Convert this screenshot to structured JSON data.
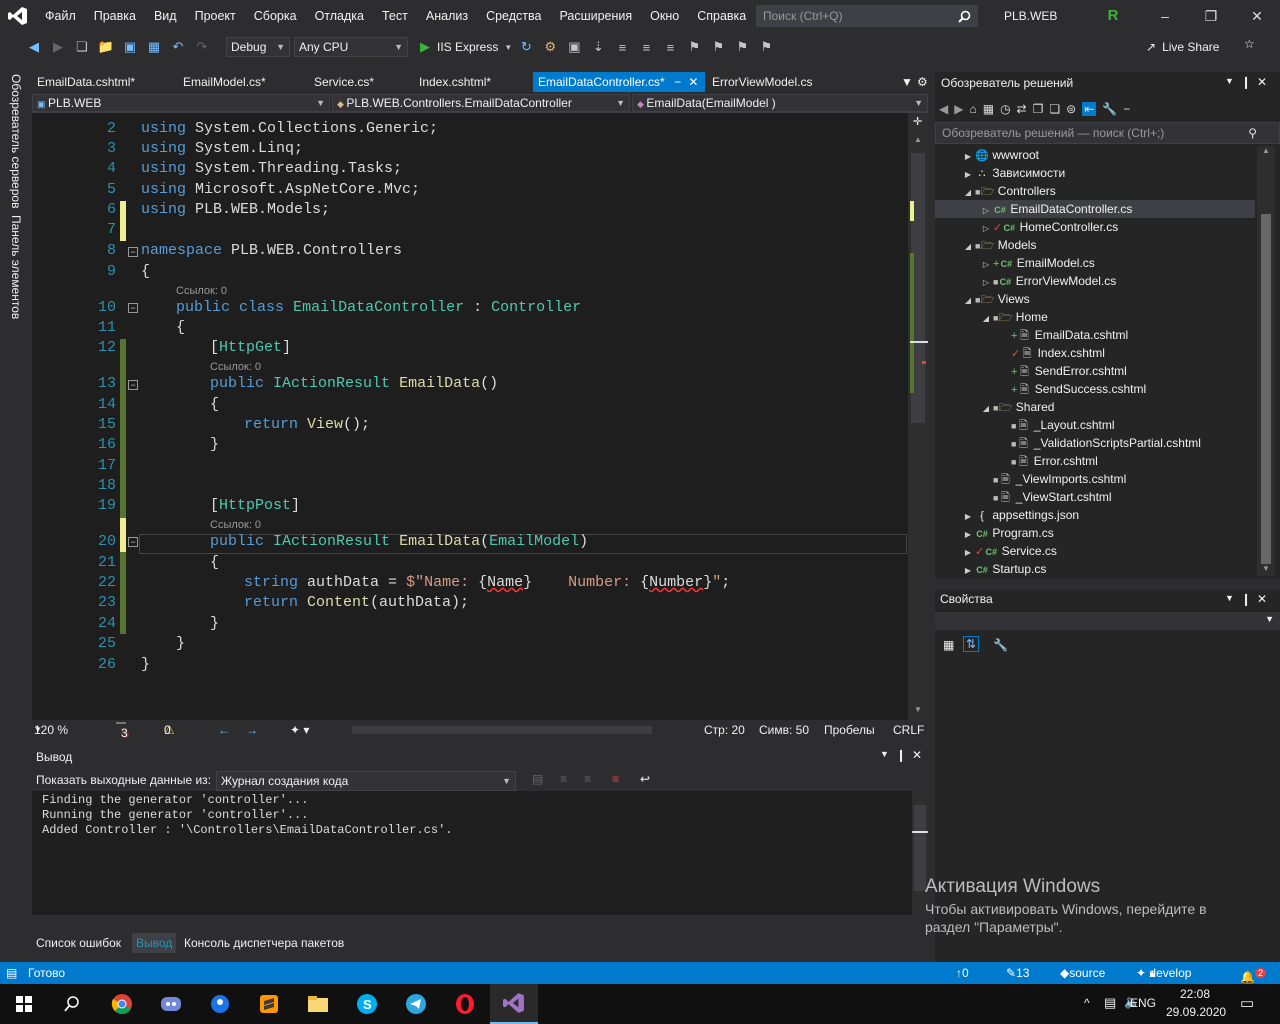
{
  "menu": {
    "items": [
      "Файл",
      "Правка",
      "Вид",
      "Проект",
      "Сборка",
      "Отладка",
      "Тест",
      "Анализ",
      "Средства",
      "Расширения",
      "Окно",
      "Справка"
    ],
    "search_placeholder": "Поиск (Ctrl+Q)",
    "project_name": "PLB.WEB",
    "avatar_letter": "R"
  },
  "toolbar": {
    "config": "Debug",
    "platform": "Any CPU",
    "run_target": "IIS Express",
    "live_share": "Live Share"
  },
  "tabs": [
    {
      "label": "EmailData.cshtml*"
    },
    {
      "label": "EmailModel.cs*"
    },
    {
      "label": "Service.cs*"
    },
    {
      "label": "Index.cshtml*"
    },
    {
      "label": "EmailDataController.cs*"
    },
    {
      "label": "ErrorViewModel.cs"
    }
  ],
  "navbar": {
    "project": "PLB.WEB",
    "class": "PLB.WEB.Controllers.EmailDataController",
    "member": "EmailData(EmailModel )"
  },
  "left_strip": {
    "server_explorer": "Обозреватель серверов",
    "toolbox": "Панель элементов"
  },
  "code": {
    "ref_label": "Ссылок: 0",
    "line_numbers": [
      "2",
      "3",
      "4",
      "5",
      "6",
      "7",
      "8",
      "9",
      "10",
      "11",
      "12",
      "13",
      "14",
      "15",
      "16",
      "17",
      "18",
      "19",
      "20",
      "21",
      "22",
      "23",
      "24",
      "25",
      "26"
    ],
    "lines": {
      "l2_kw": "using",
      "l2_rest": " System.Collections.Generic;",
      "l3_kw": "using",
      "l3_rest": " System.Linq;",
      "l4_kw": "using",
      "l4_rest": " System.Threading.Tasks;",
      "l5_kw": "using",
      "l5_rest": " Microsoft.AspNetCore.Mvc;",
      "l6_kw": "using",
      "l6_rest": " PLB.WEB.Models;",
      "l8_kw": "namespace",
      "l8_rest": " PLB.WEB.Controllers",
      "brace_open": "{",
      "brace_close": "}",
      "l10_kw1": "public",
      "l10_kw2": "class",
      "l10_name": "EmailDataController",
      "l10_colon": " : ",
      "l10_base": "Controller",
      "l12_attr": "HttpGet",
      "l13_kw": "public",
      "l13_type": "IActionResult",
      "l13_name": "EmailData",
      "l13_parens": "()",
      "l15_kw": "return",
      "l15_fn": "View",
      "l15_rest": "();",
      "l19_attr": "HttpPost",
      "l20_kw": "public",
      "l20_type": "IActionResult",
      "l20_name": "EmailData",
      "l20_open": "(",
      "l20_param": "EmailModel",
      "l20_close": ")",
      "l22_kw": "string",
      "l22_var": "authData",
      "l22_eq": " = ",
      "l22_s1": "$\"Name: ",
      "l22_i1": "Name",
      "l22_s2": "    Number: ",
      "l22_i2": "Number",
      "l22_s3": "\"",
      "l22_end": ";",
      "l23_kw": "return",
      "l23_fn": "Content",
      "l23_rest": "(authData);"
    }
  },
  "editor_status": {
    "zoom": "120 %",
    "errors": "3",
    "warnings": "0",
    "line": "Стр: 20",
    "col": "Симв: 50",
    "spaces": "Пробелы",
    "eol": "CRLF"
  },
  "output": {
    "title": "Вывод",
    "show_label": "Показать выходные данные из:",
    "source": "Журнал создания кода",
    "lines": [
      "Finding the generator 'controller'...",
      "Running the generator 'controller'...",
      "Added Controller : '\\Controllers\\EmailDataController.cs'."
    ]
  },
  "bottom_tabs": [
    "Список ошибок",
    "Вывод",
    "Консоль диспетчера пакетов"
  ],
  "solution": {
    "title": "Обозреватель решений",
    "search_placeholder": "Обозреватель решений — поиск (Ctrl+;)",
    "items": [
      {
        "label": "wwwroot"
      },
      {
        "label": "Зависимости"
      },
      {
        "label": "Controllers"
      },
      {
        "label": "EmailDataController.cs"
      },
      {
        "label": "HomeController.cs"
      },
      {
        "label": "Models"
      },
      {
        "label": "EmailModel.cs"
      },
      {
        "label": "ErrorViewModel.cs"
      },
      {
        "label": "Views"
      },
      {
        "label": "Home"
      },
      {
        "label": "EmailData.cshtml"
      },
      {
        "label": "Index.cshtml"
      },
      {
        "label": "SendError.cshtml"
      },
      {
        "label": "SendSuccess.cshtml"
      },
      {
        "label": "Shared"
      },
      {
        "label": "_Layout.cshtml"
      },
      {
        "label": "_ValidationScriptsPartial.cshtml"
      },
      {
        "label": "Error.cshtml"
      },
      {
        "label": "_ViewImports.cshtml"
      },
      {
        "label": "_ViewStart.cshtml"
      },
      {
        "label": "appsettings.json"
      },
      {
        "label": "Program.cs"
      },
      {
        "label": "Service.cs"
      },
      {
        "label": "Startup.cs"
      }
    ]
  },
  "properties": {
    "title": "Свойства"
  },
  "statusbar": {
    "ready": "Готово",
    "up": "0",
    "edits": "13",
    "repo": "source",
    "branch": "develop",
    "notifications": "2"
  },
  "watermark": {
    "title": "Активация Windows",
    "line1": "Чтобы активировать Windows, перейдите в",
    "line2": "раздел \"Параметры\"."
  },
  "taskbar": {
    "lang": "ENG",
    "time": "22:08",
    "date": "29.09.2020"
  },
  "colors": {
    "accent": "#007acc",
    "keyword": "#569cd6",
    "type": "#4ec9b0",
    "string": "#d69d85",
    "function": "#dcdcaa"
  }
}
